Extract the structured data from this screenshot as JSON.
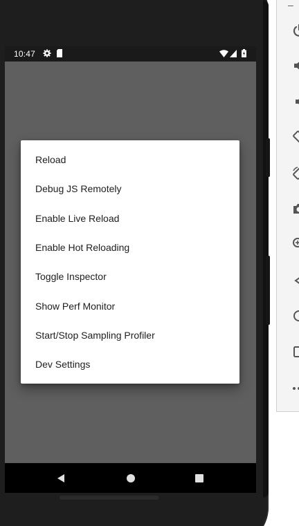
{
  "status_bar": {
    "time": "10:47",
    "icons": [
      "gear-icon",
      "sd-card-icon",
      "wifi-icon",
      "signal-icon",
      "battery-icon"
    ]
  },
  "dev_menu": {
    "items": [
      {
        "label": "Reload"
      },
      {
        "label": "Debug JS Remotely"
      },
      {
        "label": "Enable Live Reload"
      },
      {
        "label": "Enable Hot Reloading"
      },
      {
        "label": "Toggle Inspector"
      },
      {
        "label": "Show Perf Monitor"
      },
      {
        "label": "Start/Stop Sampling Profiler"
      },
      {
        "label": "Dev Settings"
      }
    ]
  },
  "navigation_bar": {
    "buttons": [
      "back-icon",
      "home-icon",
      "recents-icon"
    ]
  },
  "emulator_toolbar": {
    "minimize_label": "–",
    "buttons": [
      "power-icon",
      "volume-up-icon",
      "volume-down-icon",
      "rotate-left-icon",
      "rotate-right-icon",
      "camera-icon",
      "zoom-icon",
      "back-icon",
      "home-icon",
      "overview-icon",
      "more-icon"
    ]
  },
  "colors": {
    "scrim": "#5f5f5f",
    "status_bar": "#1a1a1a",
    "nav_bar": "#000000",
    "dialog": "#ffffff",
    "text": "#202020",
    "phone_body": "#1e1e1e",
    "toolbar_icon": "#555555"
  }
}
